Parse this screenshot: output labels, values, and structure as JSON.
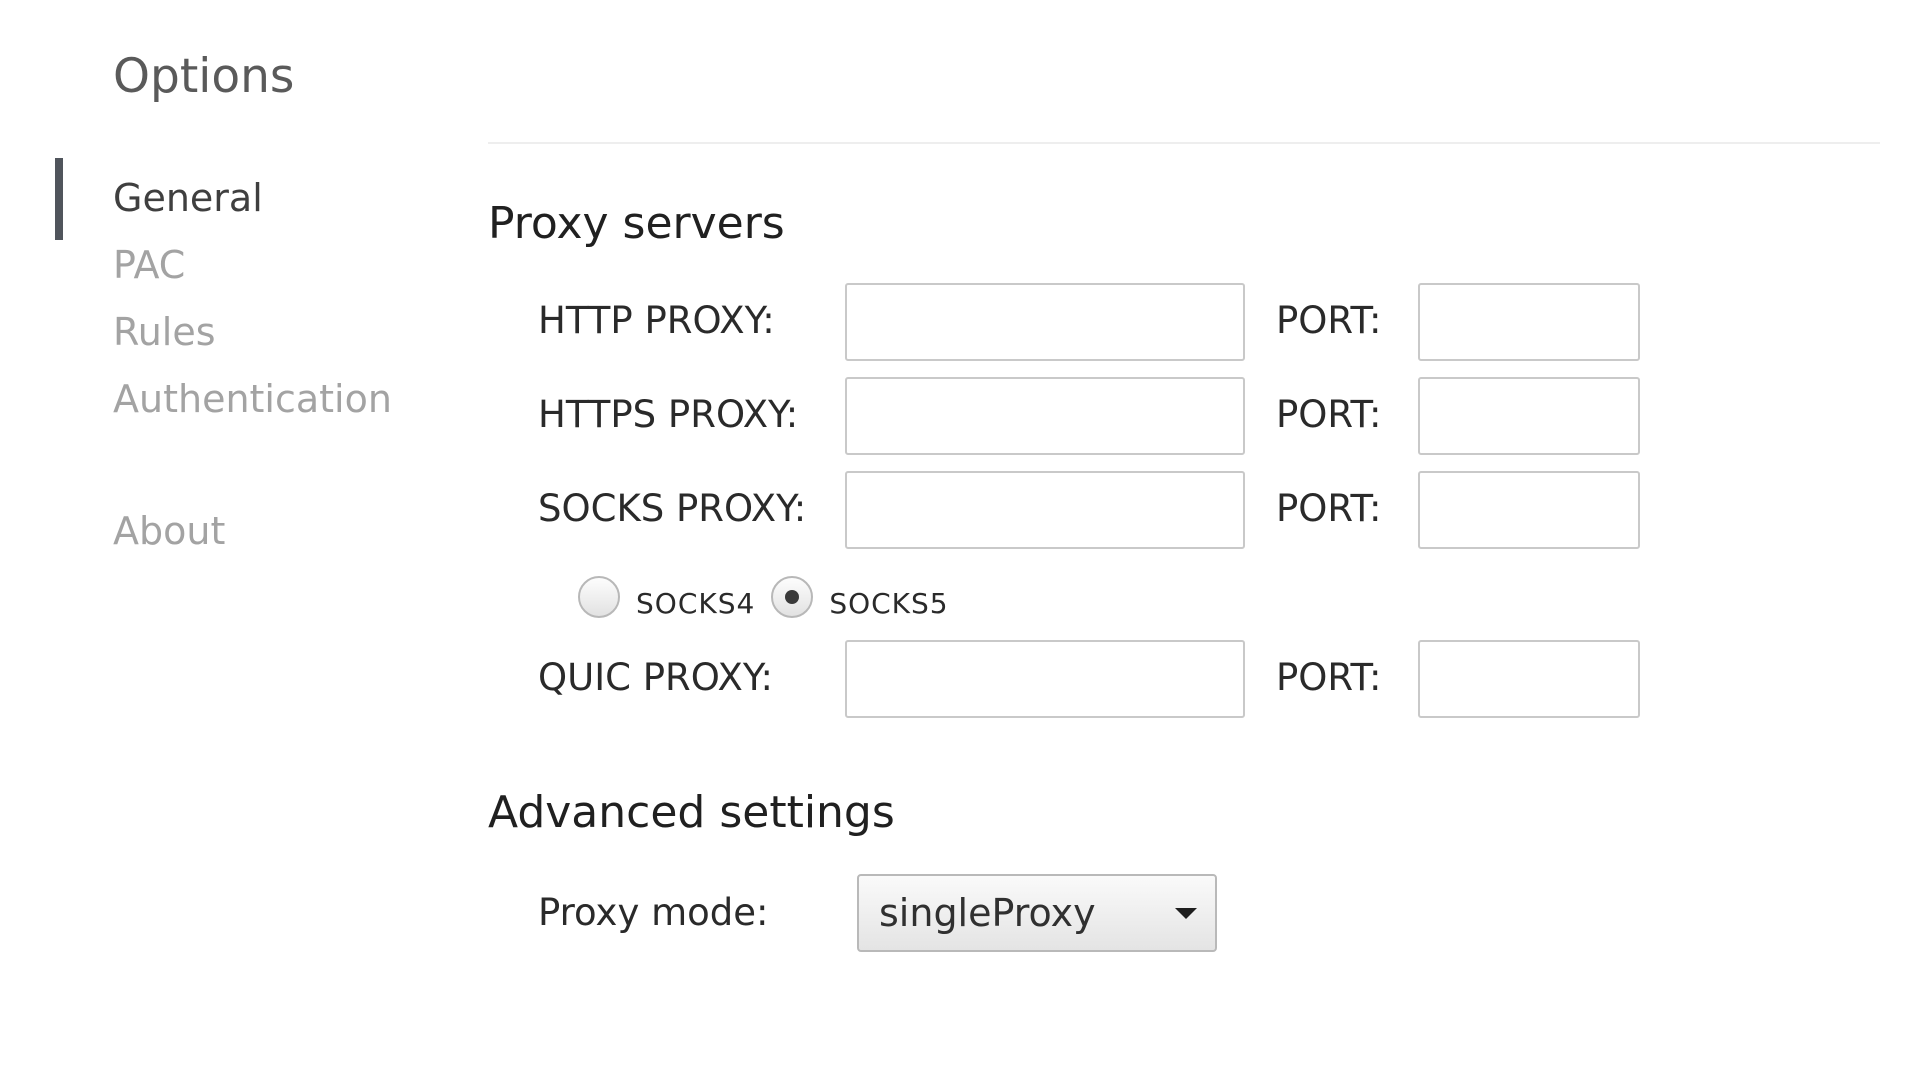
{
  "app": {
    "title": "Options"
  },
  "sidebar": {
    "items": [
      {
        "label": "General",
        "selected": true
      },
      {
        "label": "PAC",
        "selected": false
      },
      {
        "label": "Rules",
        "selected": false
      },
      {
        "label": "Authentication",
        "selected": false
      },
      {
        "label": "About",
        "selected": false
      }
    ]
  },
  "proxy_servers": {
    "heading": "Proxy servers",
    "port_label": "PORT:",
    "rows": [
      {
        "label": "HTTP PROXY:",
        "value": "",
        "port": ""
      },
      {
        "label": "HTTPS PROXY:",
        "value": "",
        "port": ""
      },
      {
        "label": "SOCKS PROXY:",
        "value": "",
        "port": ""
      },
      {
        "label": "QUIC PROXY:",
        "value": "",
        "port": ""
      }
    ],
    "socks_version": {
      "options": [
        {
          "label": "SOCKS4",
          "checked": false
        },
        {
          "label": "SOCKS5",
          "checked": true
        }
      ]
    }
  },
  "advanced": {
    "heading": "Advanced settings",
    "proxy_mode_label": "Proxy mode:",
    "proxy_mode_value": "singleProxy"
  },
  "colors": {
    "selected_marker": "#50555c",
    "nav_inactive": "#a3a3a3",
    "nav_active": "#3f3f3f"
  }
}
